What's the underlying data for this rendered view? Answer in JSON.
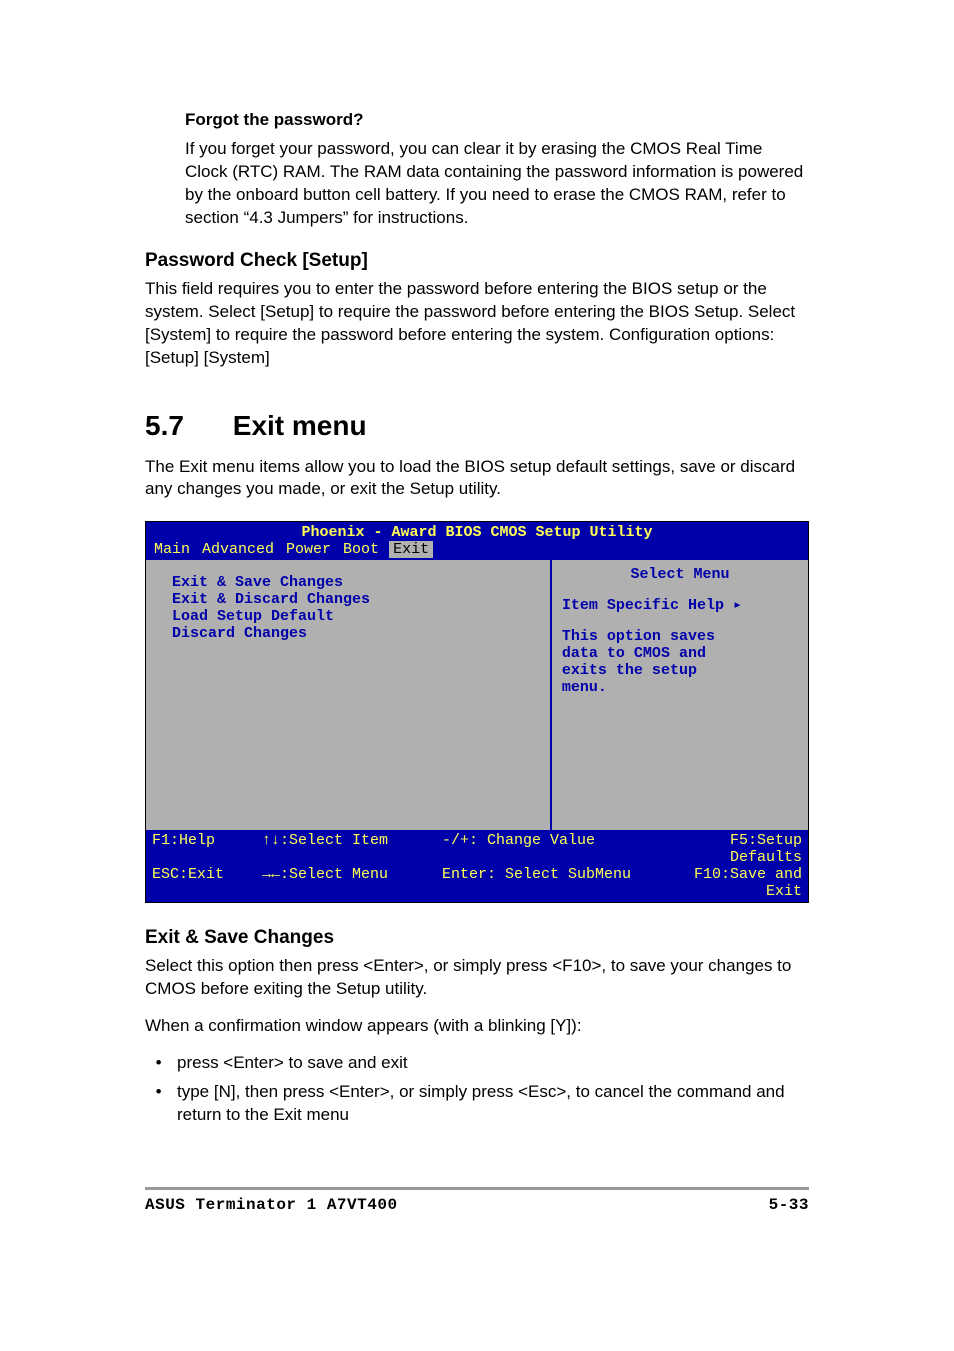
{
  "forgot": {
    "heading": "Forgot the password?",
    "text": "If you forget your password, you can clear it by erasing the CMOS Real Time Clock (RTC) RAM. The RAM data containing the password information is powered by the onboard button cell battery. If you need to erase the CMOS RAM, refer to section “4.3 Jumpers” for instructions."
  },
  "password_check": {
    "heading": "Password Check [Setup]",
    "text": "This field requires you to enter the password before entering the BIOS setup or the system. Select [Setup] to require the password before entering the BIOS Setup. Select [System] to require the password before entering the system. Configuration options: [Setup] [System]"
  },
  "exit_menu": {
    "num": "5.7",
    "title": "Exit menu",
    "intro": "The Exit menu items allow you to load the BIOS setup default settings, save or discard any changes you made, or exit the Setup utility."
  },
  "bios": {
    "title": "Phoenix - Award BIOS CMOS Setup Utility",
    "tabs": {
      "main": "Main",
      "advanced": "Advanced",
      "power": "Power",
      "boot": "Boot",
      "exit": "Exit"
    },
    "items": {
      "a": "Exit & Save Changes",
      "b": "Exit & Discard Changes",
      "c": "Load Setup Default",
      "d": "Discard Changes"
    },
    "right": {
      "title": "Select Menu",
      "help_label": "Item Specific Help",
      "help_line1": "This option saves",
      "help_line2": "data to CMOS and",
      "help_line3": "exits the setup",
      "help_line4": "menu."
    },
    "footer": {
      "r1c1": "F1:Help",
      "r1c2": "↑↓:Select Item",
      "r1c3": "-/+: Change Value",
      "r1c4": "F5:Setup Defaults",
      "r2c1": "ESC:Exit",
      "r2c2": "→←:Select Menu",
      "r2c3": "Enter: Select SubMenu",
      "r2c4": "F10:Save and Exit"
    }
  },
  "exit_save": {
    "heading": "Exit & Save Changes",
    "p1": "Select this option then press <Enter>, or simply press <F10>, to save your changes to CMOS before exiting the Setup utility.",
    "p2": "When a confirmation window appears (with a blinking [Y]):",
    "b1": "press <Enter> to save and exit",
    "b2": "type [N], then press <Enter>, or simply press <Esc>, to cancel the command and return to the Exit menu"
  },
  "footer": {
    "left": "ASUS Terminator 1 A7VT400",
    "right": "5-33"
  }
}
